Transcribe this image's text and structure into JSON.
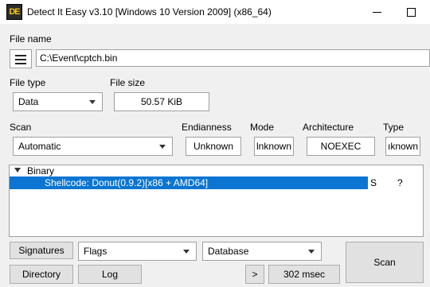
{
  "window": {
    "title": "Detect It Easy v3.10 [Windows 10 Version 2009] (x86_64)",
    "icon_text": "DE"
  },
  "file": {
    "label": "File name",
    "path": "C:\\Event\\cptch.bin"
  },
  "file_type": {
    "label": "File type",
    "value": "Data"
  },
  "file_size": {
    "label": "File size",
    "value": "50.57 KiB"
  },
  "scan": {
    "label": "Scan",
    "value": "Automatic"
  },
  "endianness": {
    "label": "Endianness",
    "value": "Unknown"
  },
  "mode": {
    "label": "Mode",
    "value": "lnknown"
  },
  "architecture": {
    "label": "Architecture",
    "value": "NOEXEC"
  },
  "type": {
    "label": "Type",
    "value": "ıknown"
  },
  "results": {
    "group": "Binary",
    "row": {
      "text": "Shellcode: Donut(0.9.2)[x86 + AMD64]",
      "col_s": "S",
      "col_q": "?"
    }
  },
  "buttons": {
    "signatures": "Signatures",
    "flags": "Flags",
    "database": "Database",
    "scan": "Scan",
    "directory": "Directory",
    "log": "Log",
    "more": ">",
    "time": "302 msec"
  },
  "icons": [
    "app-icon",
    "list-menu-icon",
    "minimize-icon",
    "maximize-icon",
    "dropdown-arrow-icon",
    "tree-expand-icon"
  ]
}
